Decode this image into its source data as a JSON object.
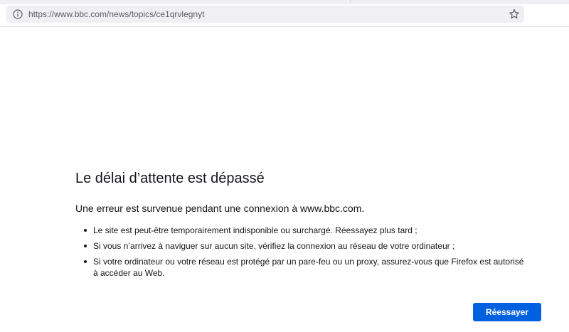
{
  "browser": {
    "url": "https://www.bbc.com/news/topics/ce1qrvlegnyt",
    "info_icon": "info-icon",
    "bookmark_icon": "star-icon"
  },
  "error_page": {
    "title": "Le délai d’attente est dépassé",
    "lead": "Une erreur est survenue pendant une connexion à www.bbc.com.",
    "items": [
      "Le site est peut-être temporairement indisponible ou surchargé. Réessayez plus tard ;",
      "Si vous n’arrivez à naviguer sur aucun site, vérifiez la connexion au réseau de votre ordinateur ;",
      "Si votre ordinateur ou votre réseau est protégé par un pare-feu ou un proxy, assurez-vous que Firefox est autorisé à accéder au Web."
    ],
    "retry_label": "Réessayer"
  },
  "colors": {
    "accent": "#0061e0",
    "urlbar_bg": "#f0f0f4",
    "text": "#15141a",
    "url_text": "#5b5b66"
  }
}
